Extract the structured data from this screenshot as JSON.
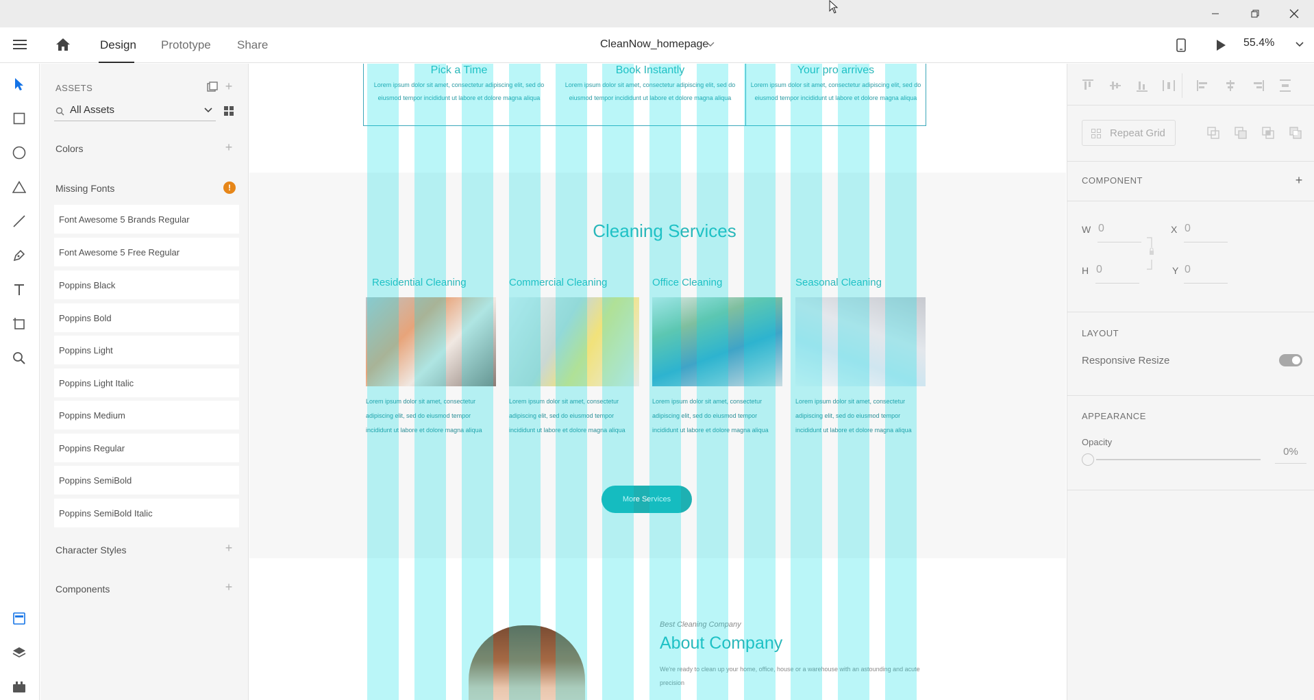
{
  "window": {
    "minimize_icon": "minimize-icon",
    "maximize_icon": "restore-icon",
    "close_icon": "close-icon"
  },
  "appbar": {
    "tabs": [
      "Design",
      "Prototype",
      "Share"
    ],
    "active_tab": "Design",
    "document_title": "CleanNow_homepage",
    "zoom": "55.4%"
  },
  "assets": {
    "header": "ASSETS",
    "search_label": "All Assets",
    "colors_label": "Colors",
    "missing_fonts_label": "Missing Fonts",
    "missing_fonts_badge": "!",
    "fonts": [
      "Font Awesome 5 Brands Regular",
      "Font Awesome 5 Free Regular",
      "Poppins Black",
      "Poppins Bold",
      "Poppins Light",
      "Poppins Light Italic",
      "Poppins Medium",
      "Poppins Regular",
      "Poppins SemiBold",
      "Poppins SemiBold Italic"
    ],
    "character_styles_label": "Character Styles",
    "components_label": "Components"
  },
  "canvas": {
    "steps": [
      {
        "title": "Pick a Time",
        "text": "Lorem ipsum dolor sit amet, consectetur adipiscing elit, sed do eiusmod tempor incididunt ut labore et dolore magna aliqua"
      },
      {
        "title": "Book Instantly",
        "text": "Lorem ipsum dolor sit amet, consectetur adipiscing elit, sed do eiusmod tempor incididunt ut labore et dolore magna aliqua"
      },
      {
        "title": "Your pro arrives",
        "text": "Lorem ipsum dolor sit amet, consectetur adipiscing elit, sed do eiusmod tempor incididunt ut labore et dolore magna aliqua"
      }
    ],
    "services_heading": "Cleaning Services",
    "services": [
      {
        "title": "Residential Cleaning",
        "text": "Lorem ipsum dolor sit amet, consectetur adipiscing elit, sed do eiusmod tempor incididunt ut labore et dolore magna aliqua"
      },
      {
        "title": "Commercial Cleaning",
        "text": "Lorem ipsum dolor sit amet, consectetur adipiscing elit, sed do eiusmod tempor incididunt ut labore et dolore magna aliqua"
      },
      {
        "title": "Office Cleaning",
        "text": "Lorem ipsum dolor sit amet, consectetur adipiscing elit, sed do eiusmod tempor incididunt ut labore et dolore magna aliqua"
      },
      {
        "title": "Seasonal Cleaning",
        "text": "Lorem ipsum dolor sit amet, consectetur adipiscing elit, sed do eiusmod tempor incididunt ut labore et dolore magna aliqua"
      }
    ],
    "more_services_label": "More Services",
    "about_kicker": "Best Cleaning Company",
    "about_title": "About Company",
    "about_text": "We're ready to clean up your home, office, house or a warehouse with an astounding and acute precision"
  },
  "props": {
    "repeat_grid_label": "Repeat Grid",
    "component_title": "COMPONENT",
    "w_label": "W",
    "w_value": "0",
    "x_label": "X",
    "x_value": "0",
    "h_label": "H",
    "h_value": "0",
    "y_label": "Y",
    "y_value": "0",
    "layout_title": "LAYOUT",
    "responsive_resize_label": "Responsive Resize",
    "responsive_resize_on": true,
    "appearance_title": "APPEARANCE",
    "opacity_label": "Opacity",
    "opacity_value": "0%"
  },
  "colors": {
    "accent": "#2ab7ba",
    "grid_overlay": "#00dce6"
  }
}
